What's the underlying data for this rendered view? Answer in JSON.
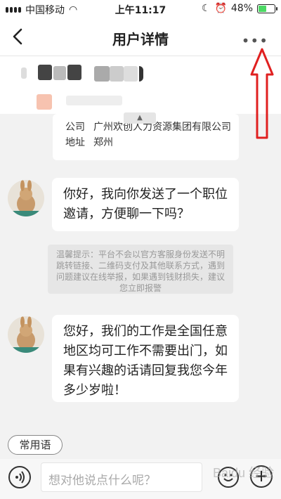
{
  "status_bar": {
    "carrier": "中国移动",
    "time": "上午11:17",
    "battery_percent": "48%",
    "battery_level": 0.48
  },
  "nav": {
    "title": "用户详情"
  },
  "company_card": {
    "company_label": "公司",
    "company_value": "广州欢创人力资源集团有限公司",
    "address_label": "地址",
    "address_value": "郑州"
  },
  "messages": [
    {
      "text": "你好，我向你发送了一个职位邀请，方便聊一下吗？"
    },
    {
      "text": "您好，我们的工作是全国任意地区均可工作不需要出门，如果有兴趣的话请回复我您今年多少岁啦！"
    }
  ],
  "warning": {
    "text": "温馨提示：平台不会以官方客服身份发送不明跳转链接、二维码支付及其他联系方式，遇到问题建议在线举报，如果遇到钱财损失，建议您立即报警"
  },
  "quick_phrase": {
    "label": "常用语"
  },
  "input": {
    "placeholder": "想对他说点什么呢？"
  },
  "watermark": "Baidu 经验",
  "colors": {
    "annotation_arrow": "#e02020",
    "battery_fill": "#4cd964"
  }
}
